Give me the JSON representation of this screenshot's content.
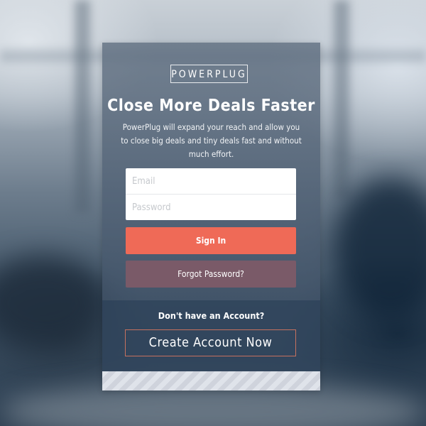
{
  "brand": {
    "logo_text": "POWERPLUG"
  },
  "hero": {
    "headline": "Close More Deals Faster",
    "subtext": "PowerPlug will expand your reach and allow you to close big deals and tiny deals fast and without much effort."
  },
  "login_form": {
    "email": {
      "placeholder": "Email",
      "value": ""
    },
    "password": {
      "placeholder": "Password",
      "value": ""
    },
    "sign_in_label": "Sign In",
    "forgot_password_label": "Forgot Password?"
  },
  "signup": {
    "prompt": "Don't have an Account?",
    "create_account_label": "Create Account Now"
  },
  "colors": {
    "sign_in_button": "#ef6a57",
    "forgot_button": "#7a5a68",
    "card_overlay": "#405268",
    "create_border": "#c6715f"
  }
}
